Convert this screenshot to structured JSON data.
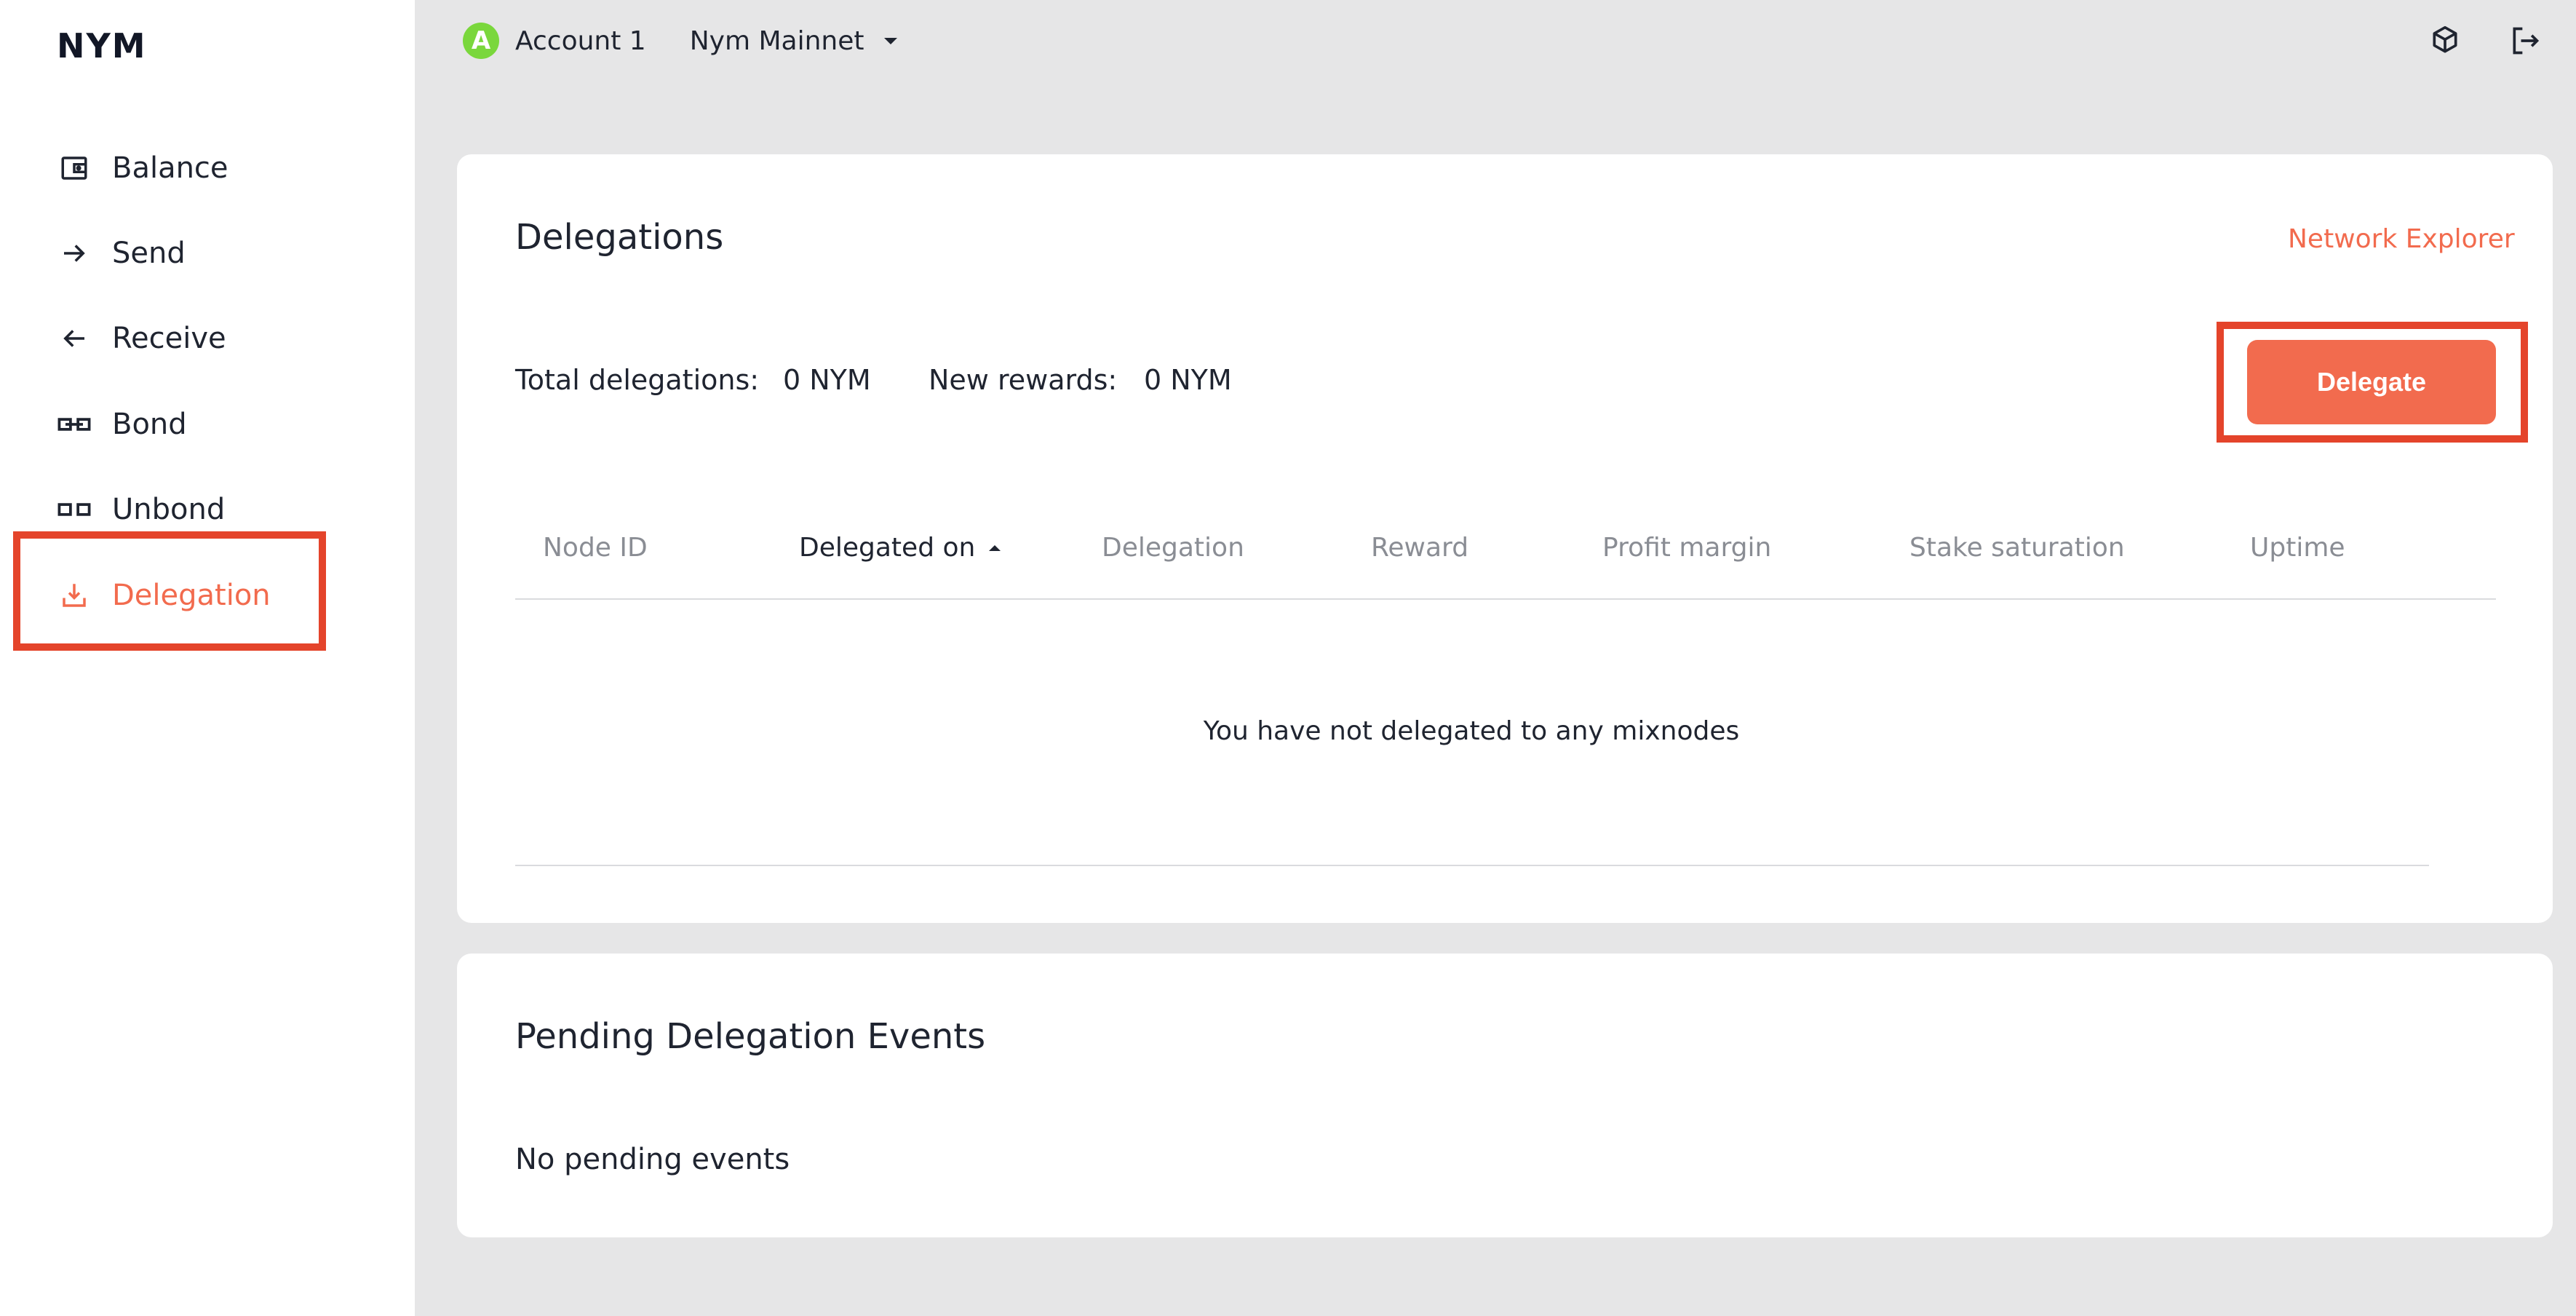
{
  "app": {
    "logo": "NYM"
  },
  "sidebar": {
    "items": [
      {
        "label": "Balance",
        "icon": "wallet-icon"
      },
      {
        "label": "Send",
        "icon": "arrow-right-icon"
      },
      {
        "label": "Receive",
        "icon": "arrow-left-icon"
      },
      {
        "label": "Bond",
        "icon": "bond-icon"
      },
      {
        "label": "Unbond",
        "icon": "unbond-icon"
      },
      {
        "label": "Delegation",
        "icon": "delegation-icon",
        "active": true
      }
    ]
  },
  "header": {
    "account_initial": "A",
    "account_name": "Account 1",
    "network": "Nym Mainnet"
  },
  "delegations": {
    "title": "Delegations",
    "explorer_link": "Network Explorer",
    "total_label": "Total delegations:",
    "total_value": "0 NYM",
    "rewards_label": "New rewards:",
    "rewards_value": "0 NYM",
    "delegate_button": "Delegate",
    "columns": [
      "Node ID",
      "Delegated on",
      "Delegation",
      "Reward",
      "Profit margin",
      "Stake saturation",
      "Uptime"
    ],
    "sorted_column": "Delegated on",
    "empty_message": "You have not delegated to any mixnodes"
  },
  "pending": {
    "title": "Pending Delegation Events",
    "empty_message": "No pending events"
  },
  "colors": {
    "accent": "#f26b4e",
    "highlight": "#e4442b",
    "avatar": "#7ad73c",
    "background": "#e6e6e7"
  }
}
